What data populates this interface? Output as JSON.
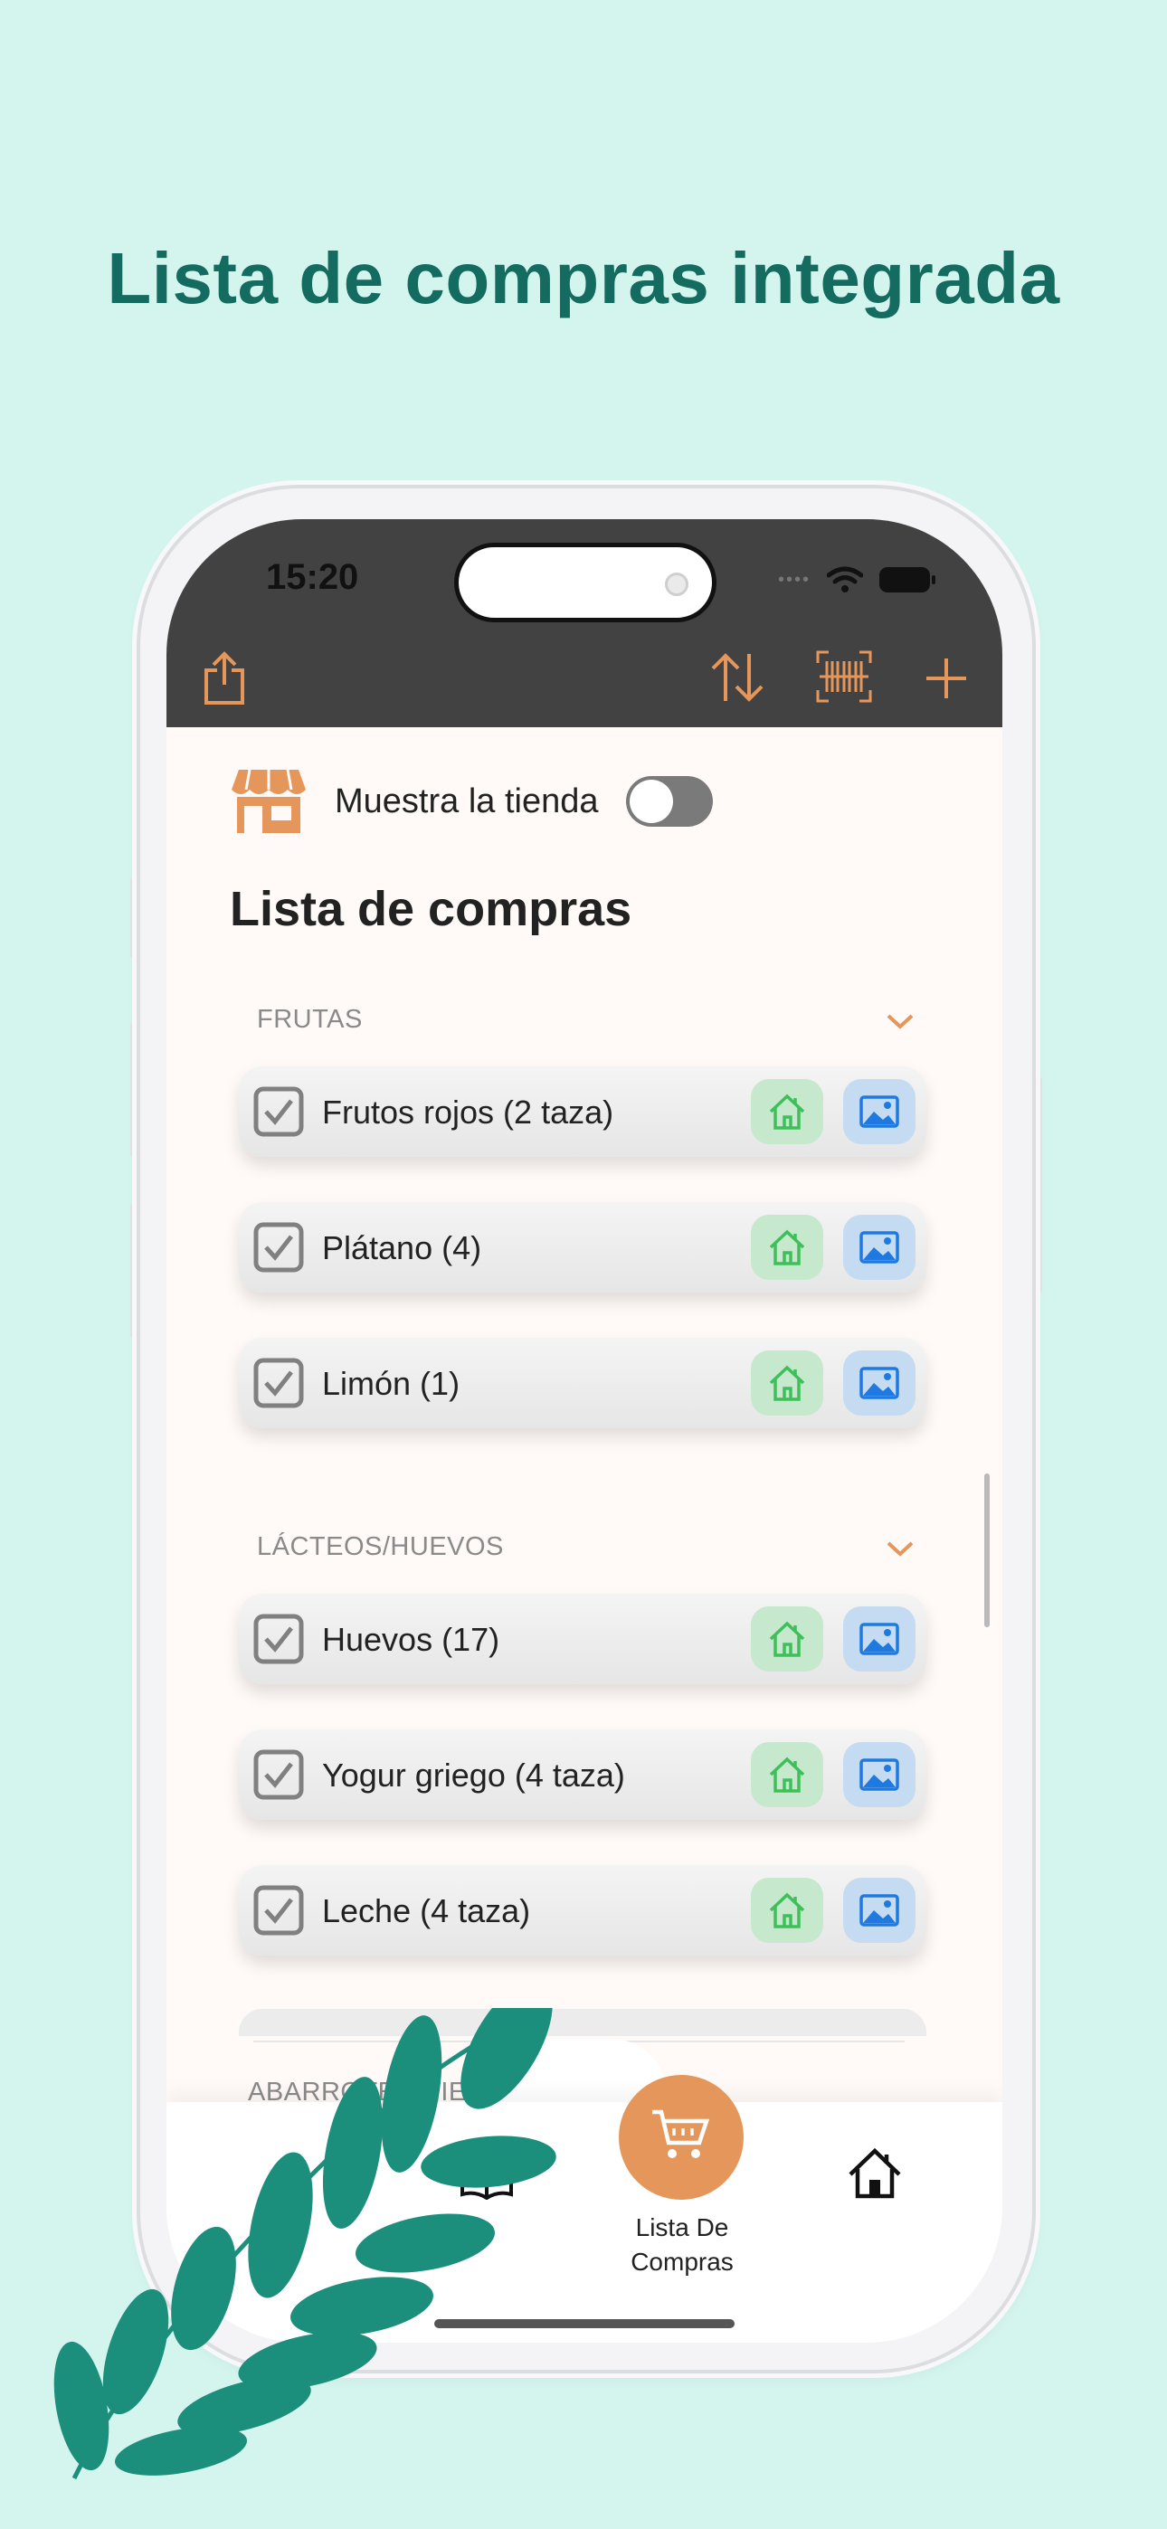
{
  "headline": "Lista de compras integrada",
  "status_bar": {
    "time": "15:20"
  },
  "toolbar": {
    "icons": [
      "share-icon",
      "sort-icon",
      "barcode-icon",
      "plus-icon"
    ],
    "accent": "#e5965b"
  },
  "store_toggle": {
    "label": "Muestra la tienda",
    "enabled": false
  },
  "list_title": "Lista de compras",
  "sections": [
    {
      "name": "FRUTAS",
      "items": [
        {
          "label": "Frutos rojos (2 taza)",
          "checked": true
        },
        {
          "label": "Plátano (4)",
          "checked": true
        },
        {
          "label": "Limón (1)",
          "checked": true
        }
      ]
    },
    {
      "name": "LÁCTEOS/HUEVOS",
      "items": [
        {
          "label": "Huevos (17)",
          "checked": true
        },
        {
          "label": "Yogur griego (4 taza)",
          "checked": true
        },
        {
          "label": "Leche (4 taza)",
          "checked": true
        }
      ]
    }
  ],
  "partial_section": "ABARROTES/HIE",
  "tabbar": {
    "active_label": "Lista De\nCompras",
    "active_line1": "Lista De",
    "active_line2": "Compras"
  },
  "colors": {
    "background": "#d4f5ee",
    "headline": "#146b5f",
    "leaf": "#1b8f7c",
    "home_btn": "#c6e8cd",
    "image_btn": "#c5dbf1"
  }
}
